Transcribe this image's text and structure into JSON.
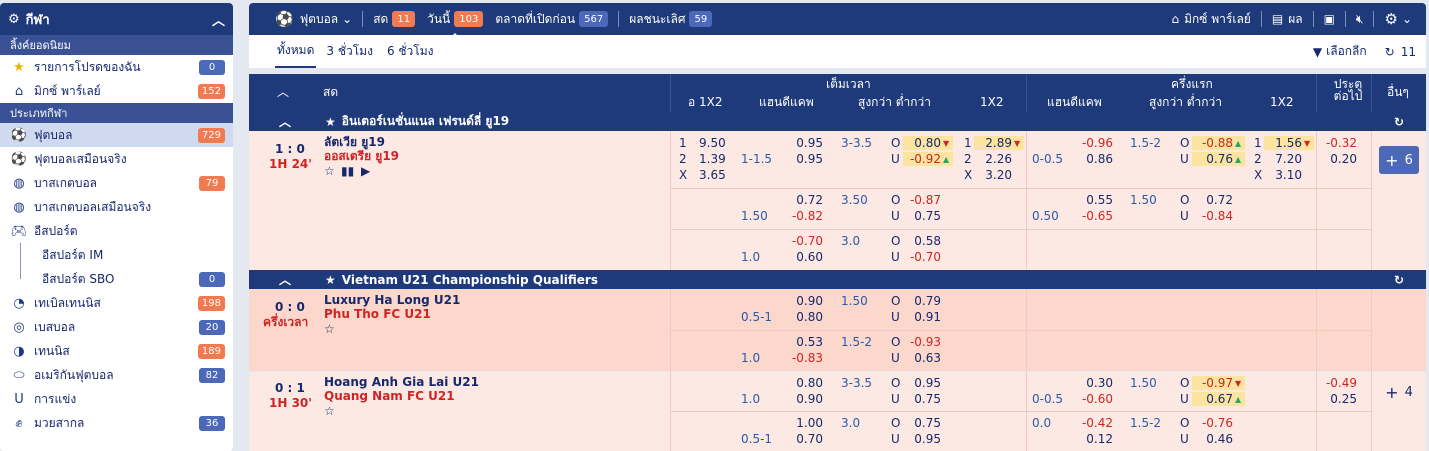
{
  "sidebar": {
    "title": "กีฬา",
    "popular_section": "ลิ้งค์ยอดนิยม",
    "popular": [
      {
        "label": "รายการโปรดของฉัน",
        "count": "0"
      },
      {
        "label": "มิกซ์ พาร์เลย์",
        "count": "152"
      }
    ],
    "sports_section": "ประเภทกีฬา",
    "sports": [
      {
        "label": "ฟุตบอล",
        "count": "729"
      },
      {
        "label": "ฟุตบอลเสมือนจริง",
        "count": ""
      },
      {
        "label": "บาสเกตบอล",
        "count": "79"
      },
      {
        "label": "บาสเกตบอลเสมือนจริง",
        "count": ""
      },
      {
        "label": "อีสปอร์ต",
        "count": ""
      }
    ],
    "esports_sub": [
      {
        "label": "อีสปอร์ต IM",
        "count": ""
      },
      {
        "label": "อีสปอร์ต SBO",
        "count": "0"
      }
    ],
    "more": [
      {
        "label": "เทเบิลเทนนิส",
        "count": "198"
      },
      {
        "label": "เบสบอล",
        "count": "20"
      },
      {
        "label": "เทนนิส",
        "count": "189"
      },
      {
        "label": "อเมริกันฟุตบอล",
        "count": "82"
      },
      {
        "label": "การแข่ง",
        "count": ""
      },
      {
        "label": "มวยสากล",
        "count": "36"
      }
    ]
  },
  "topbar": {
    "sport": "ฟุตบอล",
    "live": "สด",
    "live_count": "11",
    "today": "วันนี้",
    "today_count": "103",
    "early": "ตลาดที่เปิดก่อน",
    "early_count": "567",
    "outright": "ผลชนะเลิศ",
    "outright_count": "59",
    "parlay": "มิกซ์ พาร์เลย์",
    "results": "ผล"
  },
  "subbar": {
    "all": "ทั้งหมด",
    "h3": "3 ชั่วโมง",
    "h6": "6 ชั่วโมง",
    "filter": "เลือกลีก",
    "refresh_count": "11"
  },
  "header": {
    "live": "สด",
    "fulltime": "เต็มเวลา",
    "firsthalf": "ครึ่งแรก",
    "x12": "อ 1X2",
    "handicap": "แฮนดีแคพ",
    "ou": "สูงกว่า ต่ำกว่า",
    "x12b": "1X2",
    "handicap2": "แฮนดีแคพ",
    "ou2": "สูงกว่า ต่ำกว่า",
    "x12c": "1X2",
    "next": "ประตูต่อไป",
    "others": "อื่นๆ"
  },
  "leagues": [
    {
      "name": "อินเตอร์เนชั่นแนล เฟรนด์ลี่ ยู19"
    },
    {
      "name": "Vietnam U21 Championship Qualifiers"
    }
  ],
  "match1": {
    "score": "1 : 0",
    "time": "1H 24'",
    "home": "ลัตเวีย ยู19",
    "away": "ออสเตรีย ยู19",
    "x12": [
      [
        "1",
        "9.50"
      ],
      [
        "2",
        "1.39"
      ],
      [
        "X",
        "3.65"
      ]
    ],
    "ft": [
      {
        "hdp": "1-1.5",
        "h1": "0.95",
        "h2": "0.95",
        "ou": "3-3.5",
        "o": "0.80",
        "u": "-0.92",
        "x1": "2.89",
        "x2": "2.26",
        "xx": "3.20"
      },
      {
        "hdp": "1.50",
        "h1": "0.72",
        "h2": "-0.82",
        "ou": "3.50",
        "o": "-0.87",
        "u": "0.75"
      },
      {
        "hdp": "1.0",
        "h1": "-0.70",
        "h2": "0.60",
        "ou": "3.0",
        "o": "0.58",
        "u": "-0.70"
      }
    ],
    "fh": [
      {
        "hdp": "0-0.5",
        "h1": "-0.96",
        "h2": "0.86",
        "ou": "1.5-2",
        "o": "-0.88",
        "u": "0.76",
        "x1": "1.56",
        "x2": "7.20",
        "xx": "3.10",
        "n1": "-0.32",
        "n2": "0.20"
      },
      {
        "hdp": "0.50",
        "h1": "0.55",
        "h2": "-0.65",
        "ou": "1.50",
        "o": "0.72",
        "u": "-0.84"
      }
    ],
    "more": "6"
  },
  "match2": {
    "score": "0 : 0",
    "time": "ครึ่งเวลา",
    "home": "Luxury Ha Long U21",
    "away": "Phu Tho FC U21",
    "ft": [
      {
        "hdp": "0.5-1",
        "h1": "0.90",
        "h2": "0.80",
        "ou": "1.50",
        "o": "0.79",
        "u": "0.91"
      },
      {
        "hdp": "1.0",
        "h1": "0.53",
        "h2": "-0.83",
        "ou": "1.5-2",
        "o": "-0.93",
        "u": "0.63"
      }
    ]
  },
  "match3": {
    "score": "0 : 1",
    "time": "1H 30'",
    "home": "Hoang Anh Gia Lai U21",
    "away": "Quang Nam FC U21",
    "ft": [
      {
        "hdp": "1.0",
        "h1": "0.80",
        "h2": "0.90",
        "ou": "3-3.5",
        "o": "0.95",
        "u": "0.75"
      },
      {
        "hdp": "0.5-1",
        "h1": "1.00",
        "h2": "0.70",
        "ou": "3.0",
        "o": "0.75",
        "u": "0.95"
      }
    ],
    "fh": [
      {
        "hdp": "0-0.5",
        "h1": "0.30",
        "h2": "-0.60",
        "ou": "1.50",
        "o": "-0.97",
        "u": "0.67",
        "n1": "-0.49",
        "n2": "0.25"
      },
      {
        "hdp": "0.0",
        "h1": "-0.42",
        "h2": "0.12",
        "ou": "1.5-2",
        "o": "-0.76",
        "u": "0.46"
      }
    ],
    "more": "4"
  },
  "labels": {
    "o": "O",
    "u": "U"
  }
}
